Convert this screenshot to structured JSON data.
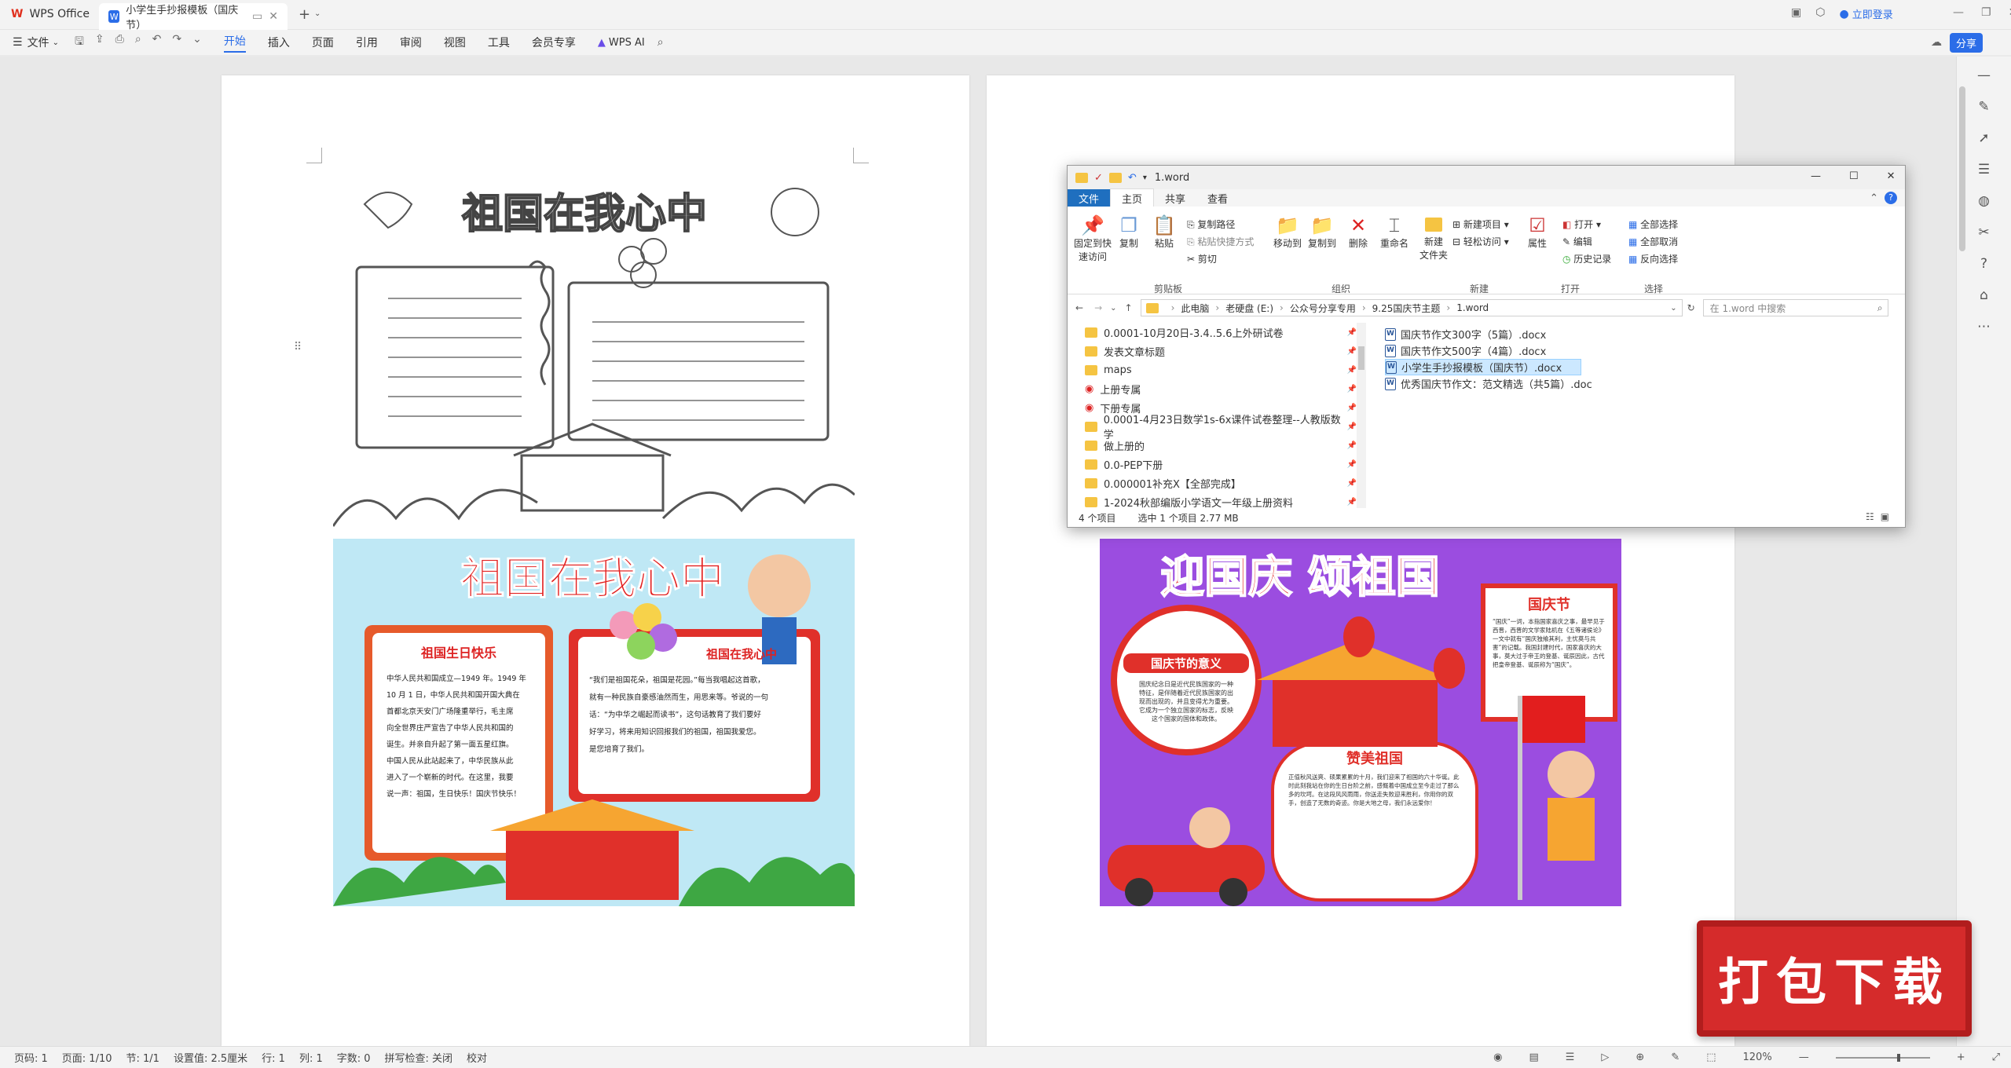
{
  "titlebar": {
    "app": "WPS Office",
    "doc_tab": "小学生手抄报模板（国庆节）",
    "login": "立即登录"
  },
  "menubar": {
    "file": "文件",
    "tabs": [
      "开始",
      "插入",
      "页面",
      "引用",
      "审阅",
      "视图",
      "工具",
      "会员专享"
    ],
    "ai": "WPS AI",
    "share": "分享"
  },
  "status": {
    "page_code": "页码: 1",
    "pages": "页面: 1/10",
    "section": "节: 1/1",
    "setting": "设置值: 2.5厘米",
    "row": "行: 1",
    "col": "列: 1",
    "words": "字数: 0",
    "spell": "拼写检查: 关闭",
    "proof": "校对",
    "zoom": "120%"
  },
  "poster_bw": {
    "title": "祖国在我心中"
  },
  "poster_color1": {
    "title": "祖国在我心中",
    "left_heading": "祖国生日快乐",
    "left_text": [
      "中华人民共和国成立—1949 年。1949 年",
      "10 月 1 日，中华人民共和国开国大典在",
      "首都北京天安门广场隆重举行，毛主席",
      "向全世界庄严宣告了中华人民共和国的",
      "诞生。并亲自升起了第一面五星红旗。",
      "中国人民从此站起来了，中华民族从此",
      "进入了一个崭新的时代。在这里，我要",
      "说一声：祖国，生日快乐！国庆节快乐！"
    ],
    "right_heading": "祖国在我心中",
    "right_text": [
      "“我们是祖国花朵，祖国是花园。”每当我唱起这首歌，",
      "就有一种民族自豪感油然而生，用思来等。爷说的一句",
      "话：“为中华之崛起而读书”，这句话教育了我们要好",
      "好学习，将来用知识回报我们的祖国，祖国我爱您。",
      "是您培育了我们。"
    ]
  },
  "poster_color2": {
    "title": "迎国庆 颂祖国",
    "circle_heading": "国庆节的意义",
    "circle_text": "国庆纪念日是近代民族国家的一种特征，是伴随着近代民族国家的出现而出现的，并且变得尤为重要。它成为一个独立国家的标志，反映这个国家的国体和政体。",
    "box_heading": "国庆节",
    "box_text": "“国庆”一词，本指国家喜庆之事，最早见于西晋，西晋的文学家陆机在《五等诸侯论》一文中就有“国庆独飨其利，主忧莫与共害”的记载。我国封建时代，国家喜庆的大事，莫大过于帝王的登基、诞辰因此，古代把皇帝登基、诞辰称为“国庆”。",
    "bottom_heading": "赞美祖国",
    "bottom_text": "正值秋风送爽、硕果累累的十月，我们迎来了祖国的六十华诞。此时此刻我站在你的生日台阶之前，感慨着中国成立至今走过了那么多的坎坷。在这段风风雨雨，你送走失败迎来胜利，你用你的双手，创造了无数的奇迹。你是大地之母，我们永远爱你！"
  },
  "explorer": {
    "title": "1.word",
    "ribbon_tabs": [
      "文件",
      "主页",
      "共享",
      "查看"
    ],
    "groups": [
      "剪贴板",
      "组织",
      "新建",
      "打开",
      "选择"
    ],
    "buttons": {
      "pin": "固定到快\n速访问",
      "copy": "复制",
      "paste": "粘贴",
      "copy_path": "复制路径",
      "paste_shortcut": "粘贴快捷方式",
      "cut": "剪切",
      "move_to": "移动到",
      "copy_to": "复制到",
      "delete": "删除",
      "rename": "重命名",
      "new_folder": "新建\n文件夹",
      "new_item": "新建项目",
      "easy_access": "轻松访问",
      "properties": "属性",
      "open": "打开",
      "edit": "编辑",
      "history": "历史记录",
      "select_all": "全部选择",
      "select_none": "全部取消",
      "invert": "反向选择"
    },
    "breadcrumb": [
      "此电脑",
      "老硬盘 (E:)",
      "公众号分享专用",
      "9.25国庆节主题",
      "1.word"
    ],
    "search_placeholder": "在 1.word 中搜索",
    "nav_items": [
      "0.0001-10月20日-3.4..5.6上外研试卷",
      "发表文章标题",
      "maps",
      "上册专属",
      "下册专属",
      "0.0001-4月23日数学1s-6x课件试卷整理--人教版数学",
      "做上册的",
      "0.0-PEP下册",
      "0.000001补充X【全部完成】",
      "1-2024秋部编版小学语文一年级上册资料"
    ],
    "files": [
      "国庆节作文300字（5篇）.docx",
      "国庆节作文500字（4篇）.docx",
      "小学生手抄报模板（国庆节）.docx",
      "优秀国庆节作文：范文精选（共5篇）.doc"
    ],
    "status_items": "4 个项目",
    "status_selected": "选中 1 个项目  2.77 MB"
  },
  "download": {
    "label": "打包下载"
  }
}
